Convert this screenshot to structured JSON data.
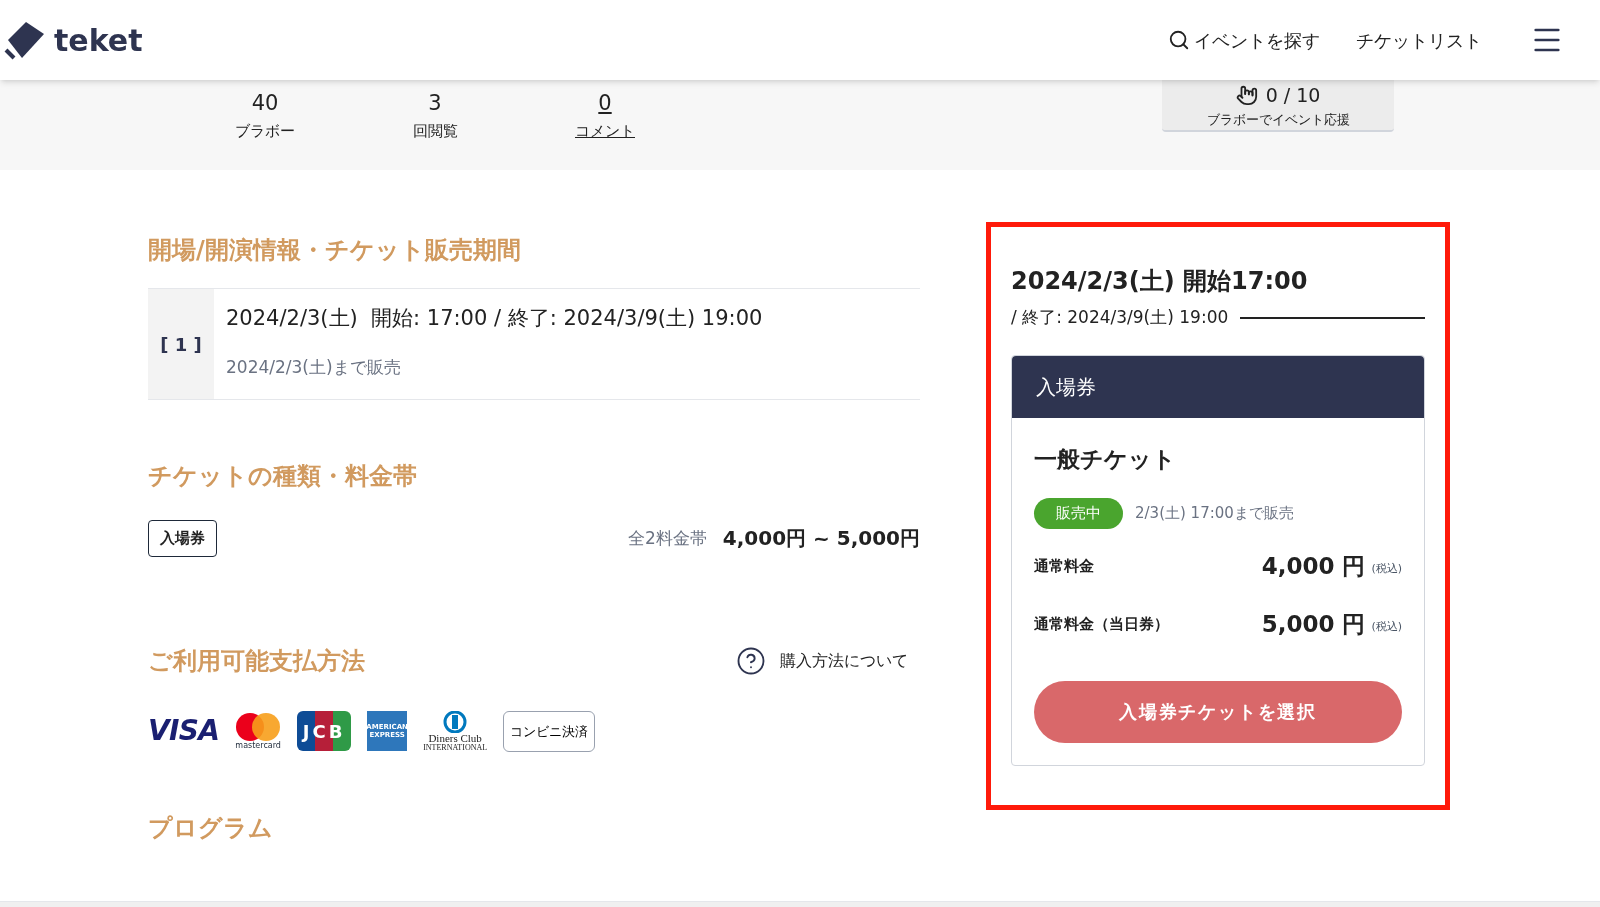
{
  "header": {
    "logo": "teket",
    "nav": [
      "イベントを探す",
      "チケットリスト"
    ]
  },
  "stats": [
    {
      "value": "40",
      "label": "ブラボー",
      "link": false
    },
    {
      "value": "3",
      "label": "回閲覧",
      "link": false
    },
    {
      "value": "0",
      "label": "コメント",
      "link": true
    }
  ],
  "bravo": {
    "count": "0 / 10",
    "label": "ブラボーでイベント応援"
  },
  "schedule": {
    "title": "開場/開演情報・チケット販売期間",
    "items": [
      {
        "index": "[ 1 ]",
        "datetime": "2024/2/3(土)  開始: 17:00 / 終了: 2024/3/9(土) 19:00",
        "sale": "2024/2/3(土)まで販売"
      }
    ]
  },
  "ticket_types": {
    "title": "チケットの種類・料金帯",
    "tag": "入場券",
    "range_label": "全2料金帯",
    "range": "4,000円 ~ 5,000円"
  },
  "payment": {
    "title": "ご利用可能支払方法",
    "help": "購入方法について",
    "methods": [
      {
        "kind": "visa",
        "label": "VISA"
      },
      {
        "kind": "mastercard",
        "label": "mastercard"
      },
      {
        "kind": "jcb",
        "label": "JCB"
      },
      {
        "kind": "amex",
        "label": "AMERICAN EXPRESS"
      },
      {
        "kind": "diners",
        "label": "Diners Club",
        "sub": "INTERNATIONAL"
      },
      {
        "kind": "text",
        "label": "コンビニ決済"
      }
    ]
  },
  "program": {
    "title": "プログラム"
  },
  "panel": {
    "date": "2024/2/3(土) 開始17:00",
    "end": "/ 終了: 2024/3/9(土) 19:00",
    "category": "入場券",
    "ticket_name": "一般チケット",
    "status": "販売中",
    "sale_until": "2/3(土) 17:00まで販売",
    "prices": [
      {
        "label": "通常料金",
        "amount": "4,000 円",
        "tax": "(税込)"
      },
      {
        "label": "通常料金（当日券）",
        "amount": "5,000 円",
        "tax": "(税込)"
      }
    ],
    "button": "入場券チケットを選択"
  }
}
